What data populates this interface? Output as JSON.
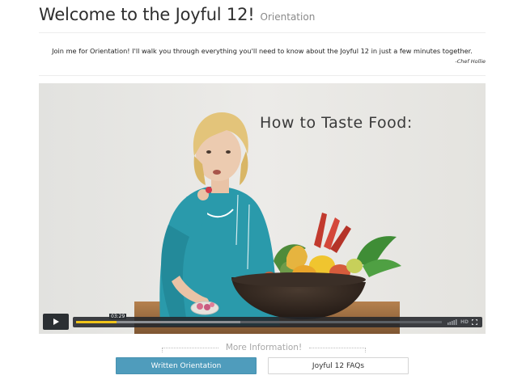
{
  "header": {
    "title": "Welcome to the Joyful 12!",
    "subtitle": "Orientation"
  },
  "intro": {
    "text": "Join me for Orientation! I'll walk you through everything you'll need to know about the Joyful 12 in just a few minutes together.",
    "signature": "-Chef Hollie"
  },
  "video": {
    "overlay_title": "How to Taste Food:",
    "timecode": "03:29",
    "progress_fraction": 0.11,
    "buffered_fraction": 0.45,
    "quality_label": "HD"
  },
  "more": {
    "label": "More Information!"
  },
  "buttons": {
    "written_orientation": "Written Orientation",
    "faqs": "Joyful 12 FAQs"
  },
  "colors": {
    "accent": "#4f9cbc",
    "progress": "#f0c419",
    "jacket": "#2a9aab"
  }
}
